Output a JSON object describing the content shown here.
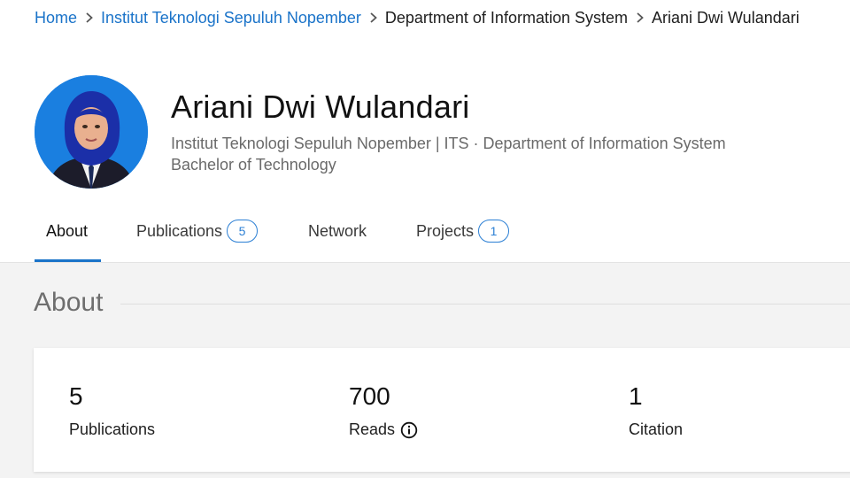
{
  "breadcrumb": {
    "items": [
      {
        "label": "Home"
      },
      {
        "label": "Institut Teknologi Sepuluh Nopember"
      },
      {
        "label": "Department of Information System"
      },
      {
        "label": "Ariani Dwi Wulandari"
      }
    ]
  },
  "profile": {
    "name": "Ariani Dwi Wulandari",
    "affiliation": "Institut Teknologi Sepuluh Nopember | ITS · Department of Information System",
    "degree": "Bachelor of Technology"
  },
  "tabs": [
    {
      "label": "About",
      "badge": null,
      "active": true
    },
    {
      "label": "Publications",
      "badge": "5",
      "active": false
    },
    {
      "label": "Network",
      "badge": null,
      "active": false
    },
    {
      "label": "Projects",
      "badge": "1",
      "active": false
    }
  ],
  "about": {
    "title": "About",
    "stats": [
      {
        "value": "5",
        "label": "Publications"
      },
      {
        "value": "700",
        "label": "Reads",
        "icon": "info-icon"
      },
      {
        "value": "1",
        "label": "Citation"
      }
    ]
  },
  "colors": {
    "link": "#1a73c9",
    "badge": "#2b7fd4",
    "avatar_bg": "#1a7fe0",
    "content_bg": "#f3f3f3"
  }
}
